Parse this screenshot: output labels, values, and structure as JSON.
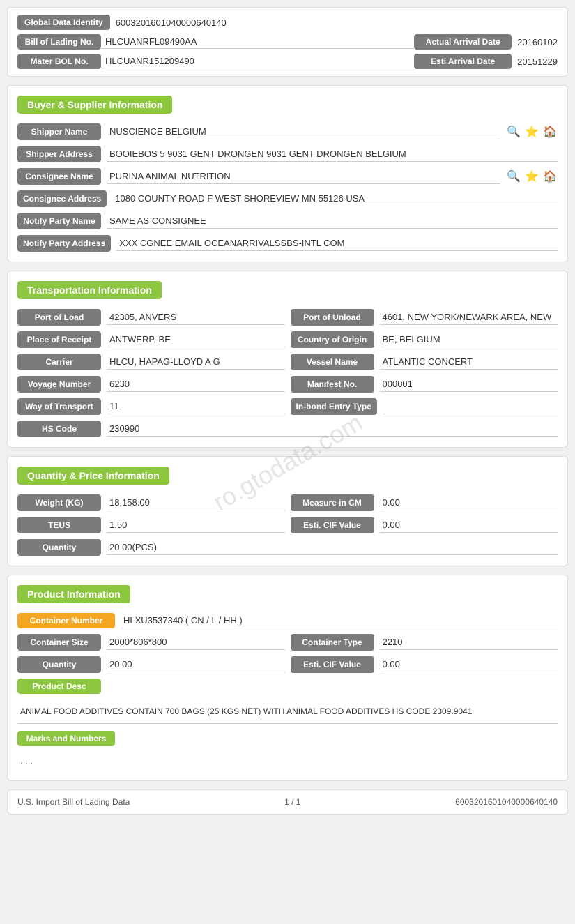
{
  "identity": {
    "global_data_label": "Global Data Identity",
    "global_data_value": "6003201601040000640140",
    "bol_label": "Bill of Lading No.",
    "bol_value": "HLCUANRFL09490AA",
    "actual_arrival_label": "Actual Arrival Date",
    "actual_arrival_value": "20160102",
    "master_bol_label": "Mater BOL No.",
    "master_bol_value": "HLCUANR151209490",
    "esti_arrival_label": "Esti Arrival Date",
    "esti_arrival_value": "20151229"
  },
  "buyer_supplier": {
    "section_title": "Buyer & Supplier Information",
    "shipper_name_label": "Shipper Name",
    "shipper_name_value": "NUSCIENCE BELGIUM",
    "shipper_address_label": "Shipper Address",
    "shipper_address_value": "BOOIEBOS 5 9031 GENT DRONGEN 9031 GENT DRONGEN BELGIUM",
    "consignee_name_label": "Consignee Name",
    "consignee_name_value": "PURINA ANIMAL NUTRITION",
    "consignee_address_label": "Consignee Address",
    "consignee_address_value": "1080 COUNTY ROAD F WEST SHOREVIEW MN 55126 USA",
    "notify_party_name_label": "Notify Party Name",
    "notify_party_name_value": "SAME AS CONSIGNEE",
    "notify_party_address_label": "Notify Party Address",
    "notify_party_address_value": "XXX CGNEE EMAIL OCEANARRIVALSSBS-INTL COM"
  },
  "transportation": {
    "section_title": "Transportation Information",
    "port_load_label": "Port of Load",
    "port_load_value": "42305, ANVERS",
    "port_unload_label": "Port of Unload",
    "port_unload_value": "4601, NEW YORK/NEWARK AREA, NEW",
    "place_receipt_label": "Place of Receipt",
    "place_receipt_value": "ANTWERP, BE",
    "country_origin_label": "Country of Origin",
    "country_origin_value": "BE, BELGIUM",
    "carrier_label": "Carrier",
    "carrier_value": "HLCU, HAPAG-LLOYD A G",
    "vessel_name_label": "Vessel Name",
    "vessel_name_value": "ATLANTIC CONCERT",
    "voyage_number_label": "Voyage Number",
    "voyage_number_value": "6230",
    "manifest_no_label": "Manifest No.",
    "manifest_no_value": "000001",
    "way_transport_label": "Way of Transport",
    "way_transport_value": "11",
    "in_bond_label": "In-bond Entry Type",
    "in_bond_value": "",
    "hs_code_label": "HS Code",
    "hs_code_value": "230990"
  },
  "quantity_price": {
    "section_title": "Quantity & Price Information",
    "weight_label": "Weight (KG)",
    "weight_value": "18,158.00",
    "measure_label": "Measure in CM",
    "measure_value": "0.00",
    "teus_label": "TEUS",
    "teus_value": "1.50",
    "esti_cif_label": "Esti. CIF Value",
    "esti_cif_value": "0.00",
    "quantity_label": "Quantity",
    "quantity_value": "20.00(PCS)"
  },
  "product": {
    "section_title": "Product Information",
    "container_number_label": "Container Number",
    "container_number_value": "HLXU3537340 ( CN / L / HH )",
    "container_size_label": "Container Size",
    "container_size_value": "2000*806*800",
    "container_type_label": "Container Type",
    "container_type_value": "2210",
    "quantity_label": "Quantity",
    "quantity_value": "20.00",
    "esti_cif_label": "Esti. CIF Value",
    "esti_cif_value": "0.00",
    "product_desc_label": "Product Desc",
    "product_desc_value": "ANIMAL FOOD ADDITIVES CONTAIN 700 BAGS (25 KGS NET) WITH ANIMAL FOOD ADDITIVES HS CODE 2309.9041",
    "marks_label": "Marks and Numbers",
    "marks_value": ". . ."
  },
  "footer": {
    "left": "U.S. Import Bill of Lading Data",
    "center": "1 / 1",
    "right": "6003201601040000640140"
  },
  "watermark": "ro.gtodata.com",
  "icons": {
    "search": "🔍",
    "star": "⭐",
    "home": "🏠"
  }
}
